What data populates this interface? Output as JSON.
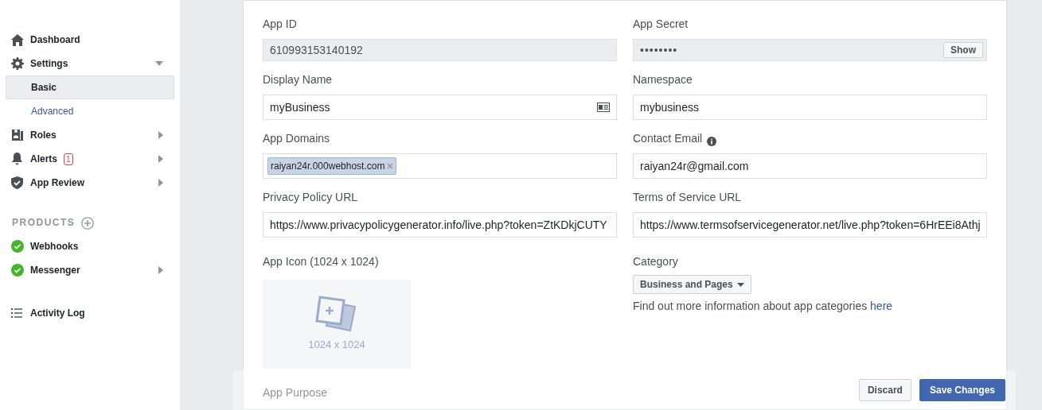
{
  "sidebar": {
    "items": [
      {
        "kind": "nav",
        "label": "Dashboard"
      },
      {
        "kind": "nav",
        "label": "Settings",
        "expanded": true
      },
      {
        "kind": "sub",
        "label": "Basic",
        "selected": true
      },
      {
        "kind": "sub",
        "label": "Advanced",
        "selected": false
      },
      {
        "kind": "nav",
        "label": "Roles",
        "expanded": false
      },
      {
        "kind": "nav",
        "label": "Alerts",
        "badge": "1",
        "expanded": false
      },
      {
        "kind": "nav",
        "label": "App Review",
        "expanded": false
      }
    ],
    "products_heading": "PRODUCTS",
    "products": [
      {
        "label": "Webhooks"
      },
      {
        "label": "Messenger",
        "expanded": false
      }
    ],
    "activity_log": "Activity Log"
  },
  "form": {
    "rows": [
      [
        {
          "kind": "readonly",
          "label": "App ID",
          "value": "610993153140192"
        },
        {
          "kind": "secret",
          "label": "App Secret",
          "value": "••••••••",
          "button": "Show"
        }
      ],
      [
        {
          "kind": "card",
          "label": "Display Name",
          "value": "myBusiness"
        },
        {
          "kind": "text",
          "label": "Namespace",
          "value": "mybusiness"
        }
      ],
      [
        {
          "kind": "tags",
          "label": "App Domains",
          "tags": [
            "raiyan24r.000webhost.com"
          ]
        },
        {
          "kind": "info",
          "label": "Contact Email",
          "value": "raiyan24r@gmail.com"
        }
      ],
      [
        {
          "kind": "text",
          "label": "Privacy Policy URL",
          "value": "https://www.privacypolicygenerator.info/live.php?token=ZtKDkjCUTY"
        },
        {
          "kind": "text",
          "label": "Terms of Service URL",
          "value": "https://www.termsofservicegenerator.net/live.php?token=6HrEEi8Athj"
        }
      ]
    ],
    "app_icon": {
      "label": "App Icon (1024 x 1024)",
      "caption": "1024 x 1024"
    },
    "category": {
      "label": "Category",
      "value": "Business and Pages",
      "help": "Find out more information about app categories",
      "link": "here"
    },
    "app_purpose": {
      "label": "App Purpose"
    }
  },
  "footer": {
    "buttons": [
      {
        "kind": "secondary",
        "label": "Discard"
      },
      {
        "kind": "primary",
        "label": "Save Changes"
      }
    ]
  }
}
